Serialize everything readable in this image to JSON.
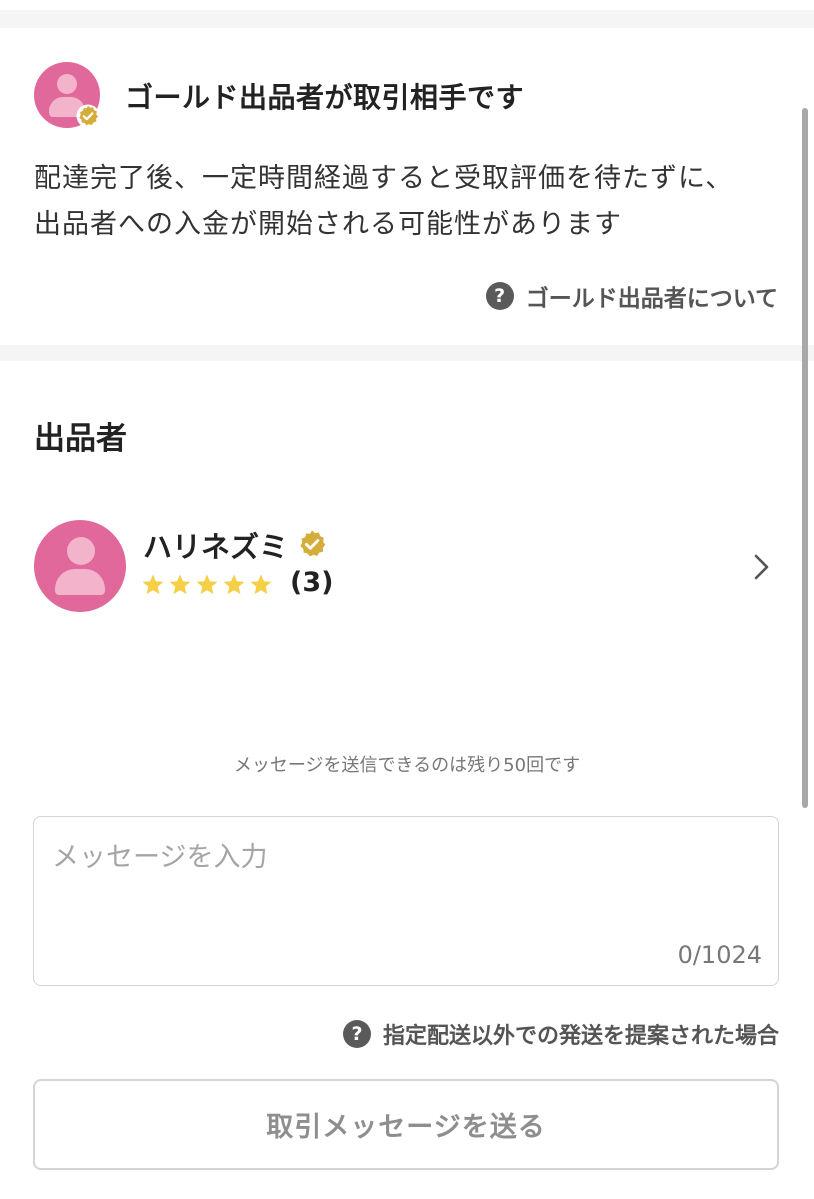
{
  "gold_notice": {
    "title": "ゴールド出品者が取引相手です",
    "description_line1": "配達完了後、一定時間経過すると受取評価を待たずに、",
    "description_line2": "出品者への入金が開始される可能性があります",
    "help_link": "ゴールド出品者について"
  },
  "seller": {
    "heading": "出品者",
    "name": "ハリネズミ",
    "rating_stars": 5,
    "rating_count": "(3)"
  },
  "message": {
    "remaining_text": "メッセージを送信できるのは残り50回です",
    "placeholder": "メッセージを入力",
    "counter": "0/1024",
    "alt_shipping_link": "指定配送以外での発送を提案された場合",
    "send_button": "取引メッセージを送る"
  },
  "help_icon_glyph": "?",
  "colors": {
    "avatar_bg": "#e0689a",
    "gold_badge": "#d4ad3a",
    "star": "#f5cf45"
  },
  "icons": {
    "avatar": "user-silhouette-icon",
    "badge": "gold-verified-badge-icon",
    "help": "question-circle-icon",
    "star": "star-icon",
    "chevron": "chevron-right-icon"
  }
}
